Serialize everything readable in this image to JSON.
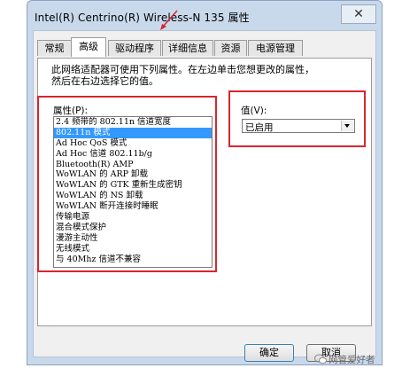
{
  "window": {
    "title": "Intel(R) Centrino(R) Wireless-N 135 属性",
    "close_glyph": "✕"
  },
  "tabs": [
    {
      "label": "常规",
      "active": false
    },
    {
      "label": "高级",
      "active": true
    },
    {
      "label": "驱动程序",
      "active": false
    },
    {
      "label": "详细信息",
      "active": false
    },
    {
      "label": "资源",
      "active": false
    },
    {
      "label": "电源管理",
      "active": false
    }
  ],
  "advanced": {
    "description_line1": "此网络适配器可使用下列属性。在左边单击您想更改的属性，",
    "description_line2": "然后在右边选择它的值。",
    "property_label": "属性(P):",
    "value_label": "值(V):",
    "value_selected": "已启用",
    "properties": [
      {
        "text": "2.4 频带的 802.11n 信道宽度",
        "selected": false
      },
      {
        "text": "802.11n 模式",
        "selected": true
      },
      {
        "text": "Ad Hoc QoS 模式",
        "selected": false
      },
      {
        "text": "Ad Hoc 信道 802.11b/g",
        "selected": false
      },
      {
        "text": "Bluetooth(R) AMP",
        "selected": false
      },
      {
        "text": "WoWLAN 的 ARP 卸载",
        "selected": false
      },
      {
        "text": "WoWLAN 的 GTK 重新生成密钥",
        "selected": false
      },
      {
        "text": "WoWLAN 的 NS 卸载",
        "selected": false
      },
      {
        "text": "WoWLAN 断开连接时睡眠",
        "selected": false
      },
      {
        "text": "传输电源",
        "selected": false
      },
      {
        "text": "混合模式保护",
        "selected": false
      },
      {
        "text": "漫游主动性",
        "selected": false
      },
      {
        "text": "无线模式",
        "selected": false
      },
      {
        "text": "与 40Mhz 信道不兼容",
        "selected": false
      }
    ]
  },
  "buttons": {
    "ok": "确定",
    "cancel": "取消"
  },
  "watermark": {
    "text": "网管爱好者"
  },
  "colors": {
    "highlight": "#d9252e",
    "selection": "#3399ff"
  }
}
